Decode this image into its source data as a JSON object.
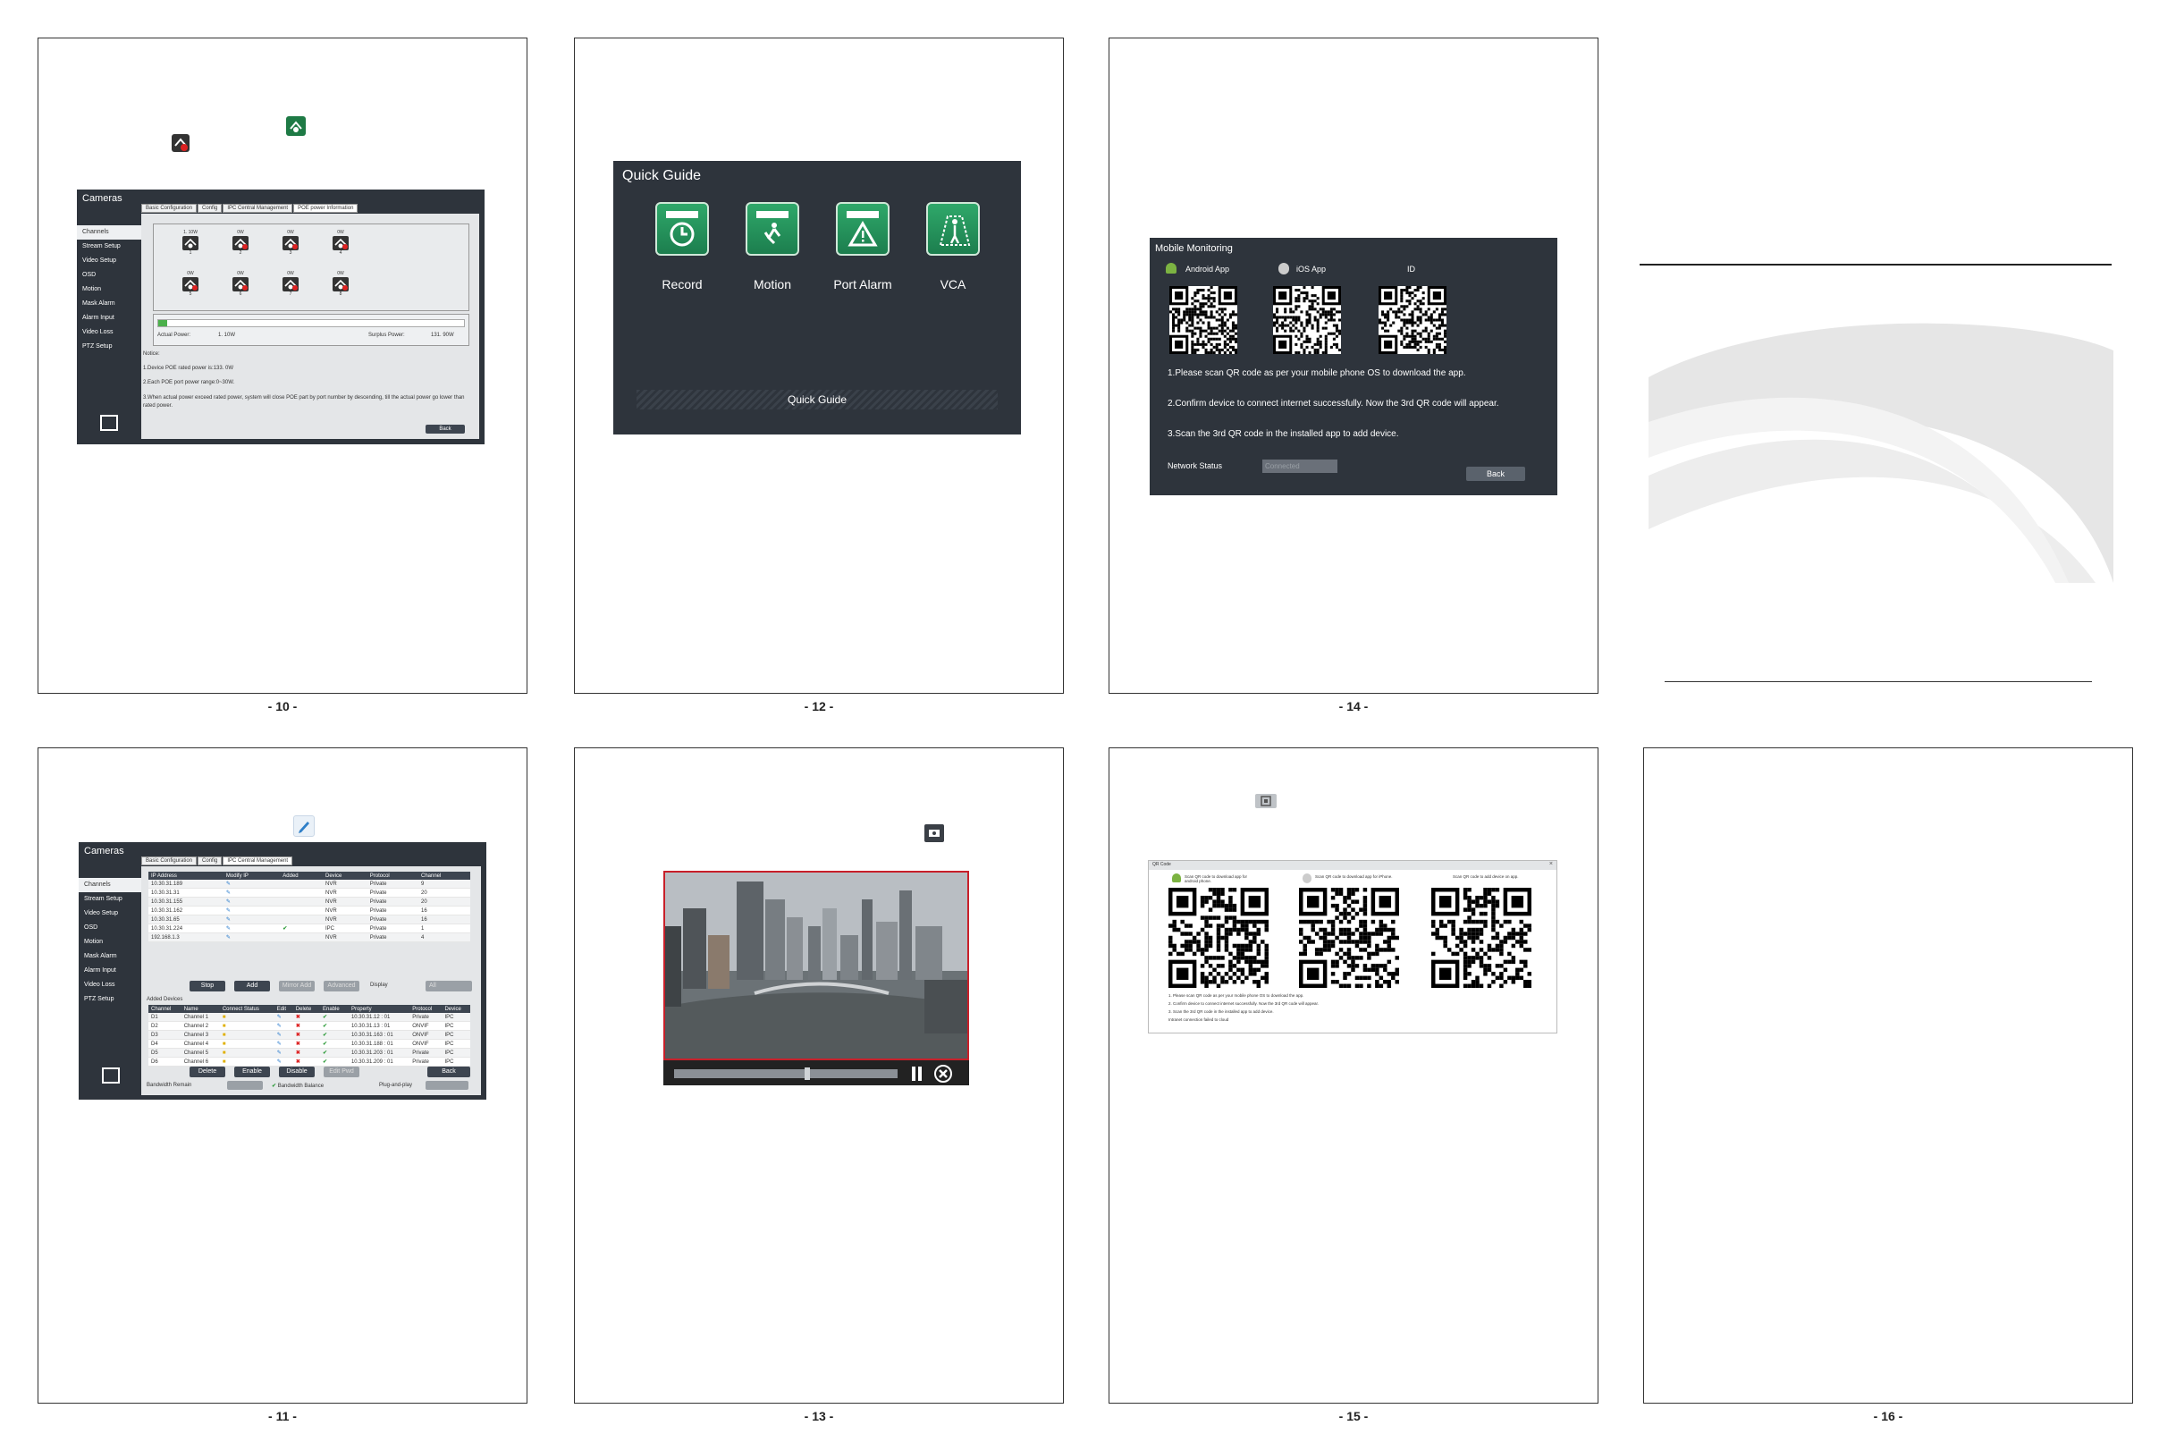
{
  "pages": [
    {
      "num": "- 10 -"
    },
    {
      "num": "- 12 -"
    },
    {
      "num": "- 14 -"
    },
    {
      "num": "- 11 -"
    },
    {
      "num": "- 13 -"
    },
    {
      "num": "- 15 -"
    },
    {
      "num": "- 16 -"
    }
  ],
  "poe": {
    "title": "Cameras",
    "tabs": [
      "Basic Configuration",
      "Config",
      "IPC Central Management",
      "POE power Information"
    ],
    "sidebar": [
      "Channels",
      "Stream Setup",
      "Video Setup",
      "OSD",
      "Motion",
      "Mask Alarm",
      "Alarm Input",
      "Video Loss",
      "PTZ Setup"
    ],
    "ports_top": [
      {
        "label": "1. 10W",
        "num": "1"
      },
      {
        "label": "0W",
        "num": "2"
      },
      {
        "label": "0W",
        "num": "3"
      },
      {
        "label": "0W",
        "num": "4"
      }
    ],
    "ports_bottom": [
      {
        "label": "0W",
        "num": "5"
      },
      {
        "label": "0W",
        "num": "6"
      },
      {
        "label": "0W",
        "num": "7"
      },
      {
        "label": "0W",
        "num": "8"
      }
    ],
    "actual_power_label": "Actual Power:",
    "actual_power_value": "1. 10W",
    "surplus_power_label": "Surplus Power:",
    "surplus_power_value": "131. 90W",
    "power_fraction": 0.03,
    "notice_title": "Notice:",
    "notices": [
      "1.Device POE rated power is:133. 0W",
      "2.Each POE port power range:0~30W.",
      "3.When actual power exceed rated power, system will close POE part by port number by descending, till the actual power go lower than rated power."
    ],
    "back_label": "Back"
  },
  "quick_guide": {
    "title": "Quick Guide",
    "items": [
      "Record",
      "Motion",
      "Port Alarm",
      "VCA"
    ],
    "footer": "Quick Guide"
  },
  "mobile": {
    "title": "Mobile Monitoring",
    "android_label": "Android App",
    "ios_label": "iOS App",
    "id_label": "ID",
    "steps": [
      "1.Please scan QR code as per your mobile phone OS to download the app.",
      "2.Confirm device to connect internet successfully. Now the 3rd QR code will appear.",
      "3.Scan the 3rd QR code in the installed app to add device."
    ],
    "network_label": "Network Status",
    "network_value": "Connected",
    "back_label": "Back"
  },
  "ipc": {
    "title": "Cameras",
    "tabs": [
      "Basic Configuration",
      "Config",
      "IPC Central Management"
    ],
    "sidebar": [
      "Channels",
      "Stream Setup",
      "Video Setup",
      "OSD",
      "Motion",
      "Mask Alarm",
      "Alarm Input",
      "Video Loss",
      "PTZ Setup"
    ],
    "search_headers": [
      "IP Address",
      "Modify IP",
      "Added",
      "Device",
      "Protocol",
      "Channel"
    ],
    "search_rows": [
      {
        "ip": "10.30.31.189",
        "added": "",
        "device": "NVR",
        "protocol": "Private",
        "channel": "9"
      },
      {
        "ip": "10.30.31.31",
        "added": "",
        "device": "NVR",
        "protocol": "Private",
        "channel": "20"
      },
      {
        "ip": "10.30.31.155",
        "added": "",
        "device": "NVR",
        "protocol": "Private",
        "channel": "20"
      },
      {
        "ip": "10.30.31.162",
        "added": "",
        "device": "NVR",
        "protocol": "Private",
        "channel": "16"
      },
      {
        "ip": "10.30.31.65",
        "added": "",
        "device": "NVR",
        "protocol": "Private",
        "channel": "16"
      },
      {
        "ip": "10.30.31.224",
        "added": "✔",
        "device": "IPC",
        "protocol": "Private",
        "channel": "1"
      },
      {
        "ip": "192.168.1.3",
        "added": "",
        "device": "NVR",
        "protocol": "Private",
        "channel": "4"
      }
    ],
    "buttons_mid": [
      "Stop",
      "Add",
      "Mirror Add",
      "Advanced"
    ],
    "display_label": "Display",
    "display_value": "All",
    "added_title": "Added Devices",
    "added_headers": [
      "Channel",
      "Name",
      "Connect Status",
      "Edit",
      "Delete",
      "Enable",
      "Property",
      "Protocol",
      "Device"
    ],
    "added_rows": [
      {
        "ch": "D1",
        "name": "Channel 1",
        "prop": "10.30.31.12 : 01",
        "proto": "Private",
        "dev": "IPC"
      },
      {
        "ch": "D2",
        "name": "Channel 2",
        "prop": "10.30.31.13 : 01",
        "proto": "ONVIF",
        "dev": "IPC"
      },
      {
        "ch": "D3",
        "name": "Channel 3",
        "prop": "10.30.31.163 : 01",
        "proto": "ONVIF",
        "dev": "IPC"
      },
      {
        "ch": "D4",
        "name": "Channel 4",
        "prop": "10.30.31.188 : 01",
        "proto": "ONVIF",
        "dev": "IPC"
      },
      {
        "ch": "D5",
        "name": "Channel 5",
        "prop": "10.30.31.203 : 01",
        "proto": "Private",
        "dev": "IPC"
      },
      {
        "ch": "D6",
        "name": "Channel 6",
        "prop": "10.30.31.209 : 01",
        "proto": "Private",
        "dev": "IPC"
      }
    ],
    "buttons_bottom": [
      "Delete",
      "Enable",
      "Disable",
      "Edit Pwd"
    ],
    "back_label": "Back",
    "bandwidth_label": "Bandwidth Remain",
    "bandwidth_balance": "Bandwidth Balance",
    "pnp_label": "Plug-and-play"
  },
  "qr_window": {
    "title": "QR Code",
    "captions": [
      "Scan QR code to download app for android phone.",
      "Scan QR code to download app for iPhone.",
      "Scan QR code to add device on app."
    ],
    "steps": [
      "1. Please scan QR code as per your mobile phone OS to download the app.",
      "2. Confirm device to connect internet successfully. Now the 3rd QR code will appear.",
      "3. Scan the 3rd QR code in the installed app to add device."
    ],
    "status": "Intranet connection failed to cloud"
  },
  "colors": {
    "dark_ui": "#2e343c",
    "accent_green": "#2fa86a",
    "red_frame": "#c8202a"
  }
}
